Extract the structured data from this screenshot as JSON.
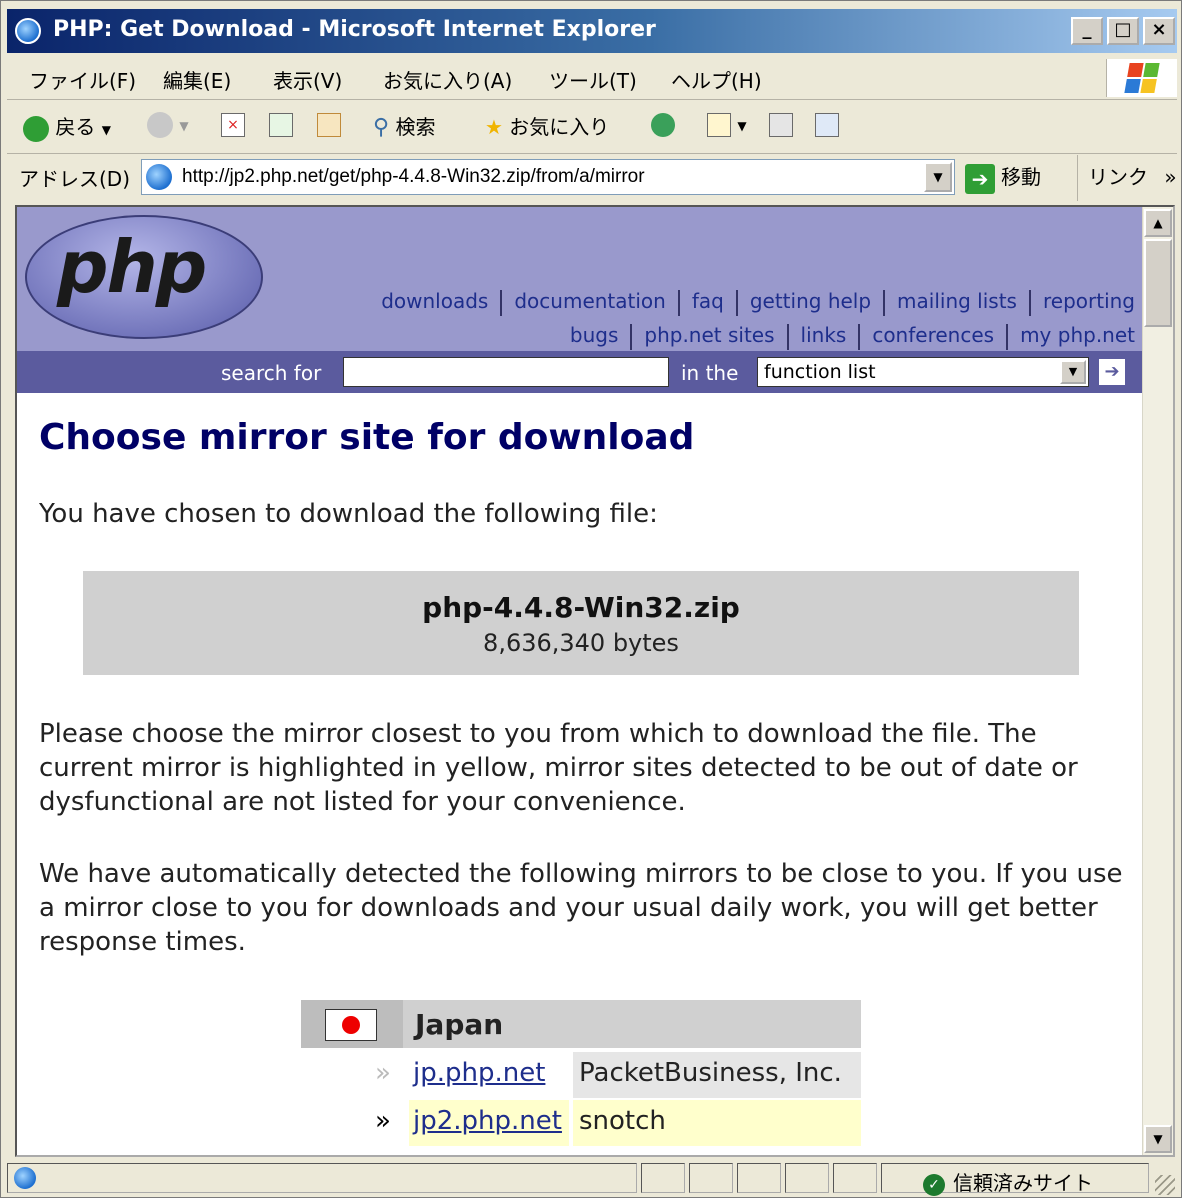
{
  "window": {
    "title": "PHP: Get Download - Microsoft Internet Explorer",
    "controls": {
      "minimize": "_",
      "maximize": "□",
      "close": "×"
    }
  },
  "menu": [
    "ファイル(F)",
    "編集(E)",
    "表示(V)",
    "お気に入り(A)",
    "ツール(T)",
    "ヘルプ(H)"
  ],
  "toolbar": {
    "back": "戻る",
    "search": "検索",
    "favorites": "お気に入り"
  },
  "address": {
    "label": "アドレス(D)",
    "url": "http://jp2.php.net/get/php-4.4.8-Win32.zip/from/a/mirror",
    "go": "移動",
    "links": "リンク",
    "more": "»"
  },
  "site": {
    "logo_text": "php",
    "nav_row1": [
      "downloads",
      "documentation",
      "faq",
      "getting help",
      "mailing lists",
      "reporting"
    ],
    "nav_row2": [
      "bugs",
      "php.net sites",
      "links",
      "conferences",
      "my php.net"
    ],
    "search_label": "search for",
    "in_the": "in the",
    "search_scope": "function list"
  },
  "page": {
    "heading": "Choose mirror site for download",
    "intro": "You have chosen to download the following file:",
    "file_name": "php-4.4.8-Win32.zip",
    "file_size": "8,636,340 bytes",
    "para1": "Please choose the mirror closest to you from which to download the file. The current mirror is highlighted in yellow, mirror sites detected to be out of date or dysfunctional are not listed for your convenience.",
    "para2": "We have automatically detected the following mirrors to be close to you. If you use a mirror close to you for downloads and your usual daily work, you will get better response times."
  },
  "mirrors": {
    "country": "Japan",
    "rows": [
      {
        "marker": "»",
        "host": "jp.php.net",
        "provider": "PacketBusiness, Inc.",
        "current": false
      },
      {
        "marker": "»",
        "host": "jp2.php.net",
        "provider": "snotch",
        "current": true
      }
    ]
  },
  "status": {
    "zone": "信頼済みサイト"
  },
  "colors": {
    "header_bg": "#9999CC",
    "searchbar_bg": "#5B5B9E",
    "heading": "#000066",
    "link": "#1E2E8C",
    "current_mirror": "#FFFFCC"
  }
}
